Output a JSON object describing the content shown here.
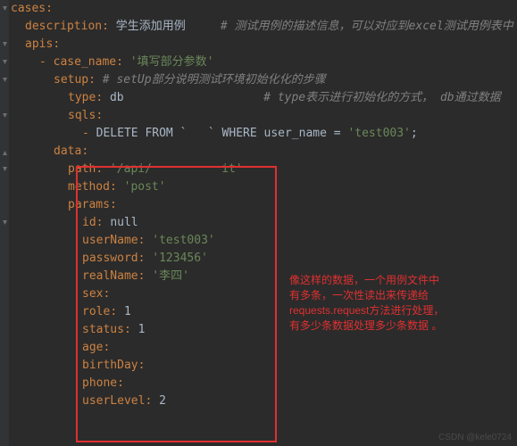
{
  "code": {
    "cases_key": "cases",
    "description_key": "description",
    "description_value": "学生添加用例",
    "description_comment": "# 测试用例的描述信息，可以对应到excel测试用例表中",
    "apis_key": "apis",
    "case_name_key": "case_name",
    "case_name_value": "'填写部分参数'",
    "setup_key": "setup",
    "setup_comment": "# setUp部分说明测试环境初始化化的步骤",
    "type_key": "type",
    "type_value": "db",
    "type_comment": "# type表示进行初始化的方式， db通过数据",
    "sqls_key": "sqls",
    "sql_delete_1": "DELETE FROM ",
    "sql_delete_2": " WHERE user_name = ",
    "sql_obscured": "`   `",
    "sql_value": "'test003'",
    "sql_semi": ";",
    "data_key": "data",
    "path_key": "path",
    "path_value": "'/api/          it'",
    "method_key": "method",
    "method_value": "'post'",
    "params_key": "params",
    "id_key": "id",
    "id_value": "null",
    "userName_key": "userName",
    "userName_value": "'test003'",
    "password_key": "password",
    "password_value": "'123456'",
    "realName_key": "realName",
    "realName_value": "'李四'",
    "sex_key": "sex",
    "role_key": "role",
    "role_value": "1",
    "status_key": "status",
    "status_value": "1",
    "age_key": "age",
    "birthDay_key": "birthDay",
    "phone_key": "phone",
    "userLevel_key": "userLevel",
    "userLevel_value": "2"
  },
  "annotation": "像这样的数据，一个用例文件中有多条，一次性读出来传递给requests.request方法进行处理，有多少条数据处理多少条数据 。",
  "watermark": "CSDN @kele0724"
}
